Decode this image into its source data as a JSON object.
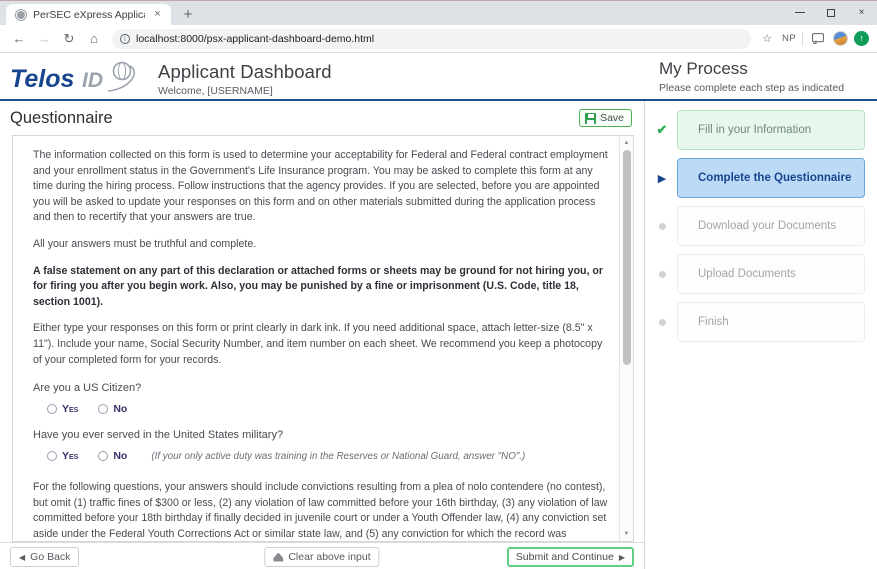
{
  "browser": {
    "tab": {
      "title": "PerSEC eXpress Applicant Dashb",
      "favicon": "globe-icon",
      "close": "×"
    },
    "new_tab": "+",
    "window_controls": {
      "minimize": "minimize-icon",
      "maximize": "maximize-icon",
      "close": "×"
    },
    "nav": {
      "back": "←",
      "forward": "→",
      "reload": "↻",
      "home": "⌂"
    },
    "omnibox": {
      "info": "ⓘ",
      "url": "localhost:8000/psx-applicant-dashboard-demo.html"
    },
    "toolbar_right": {
      "bookmark": "☆",
      "profile_label": "NP",
      "cast": "cast-icon",
      "avatar": "avatar",
      "update": "⬇"
    }
  },
  "header": {
    "logo_text": "TelosID",
    "app_title": "Applicant Dashboard",
    "welcome": "Welcome, [USERNAME]",
    "process_title": "My Process",
    "process_subtitle": "Please complete each step as indicated",
    "accent_line_color": "#1f4e8c"
  },
  "questionnaire": {
    "title": "Questionnaire",
    "save_label": "Save",
    "paragraphs": [
      {
        "bold": false,
        "text": "The information collected on this form is used to determine your acceptability for Federal and Federal contract employment and your enrollment status in the Government's Life Insurance program. You may be asked to complete this form at any time during the hiring process. Follow instructions that the agency provides. If you are selected, before you are appointed you will be asked to update your responses on this form and on other materials submitted during the application process and then to recertify that your answers are true."
      },
      {
        "bold": false,
        "text": "All your answers must be truthful and complete."
      },
      {
        "bold": true,
        "text": "A false statement on any part of this declaration or attached forms or sheets may be ground for not hiring you, or for firing you after you begin work. Also, you may be punished by a fine or imprisonment (U.S. Code, title 18, section 1001)."
      },
      {
        "bold": false,
        "text": "Either type your responses on this form or print clearly in dark ink. If you need additional space, attach letter-size (8.5\" x 11\"). Include your name, Social Security Number, and item number on each sheet. We recommend you keep a photocopy of your completed form for your records."
      }
    ],
    "questions": [
      {
        "label": "Are you a US Citizen?",
        "yes": "Yes",
        "no": "No",
        "hint": ""
      },
      {
        "label": "Have you ever served in the United States military?",
        "yes": "Yes",
        "no": "No",
        "hint": "(If your only active duty was training in the Reserves or National Guard, answer \"NO\".)"
      }
    ],
    "closing_paragraph": "For the following questions, your answers should include convictions resulting from a plea of nolo contendere (no contest), but omit (1) traffic fines of $300 or less, (2) any violation of law committed before your 16th birthday, (3) any violation of law committed before your 18th birthday if finally decided in juvenile court or under a Youth Offender law, (4) any conviction set aside under the Federal Youth Corrections Act or similar state law, and (5) any conviction for which the record was expunged under Federal or state law.",
    "closing_italic": "nolo contendere"
  },
  "footer": {
    "go_back": "Go Back",
    "clear": "Clear above input",
    "submit": "Submit and Continue",
    "submit_border_color": "#5fcf84"
  },
  "process_steps": [
    {
      "label": "Fill in your Information",
      "state": "done",
      "marker": "check-icon"
    },
    {
      "label": "Complete the Questionnaire",
      "state": "current",
      "marker": "play-arrow-icon"
    },
    {
      "label": "Download your Documents",
      "state": "todo",
      "marker": "dot-icon"
    },
    {
      "label": "Upload Documents",
      "state": "todo",
      "marker": "dot-icon"
    },
    {
      "label": "Finish",
      "state": "todo",
      "marker": "dot-icon"
    }
  ]
}
